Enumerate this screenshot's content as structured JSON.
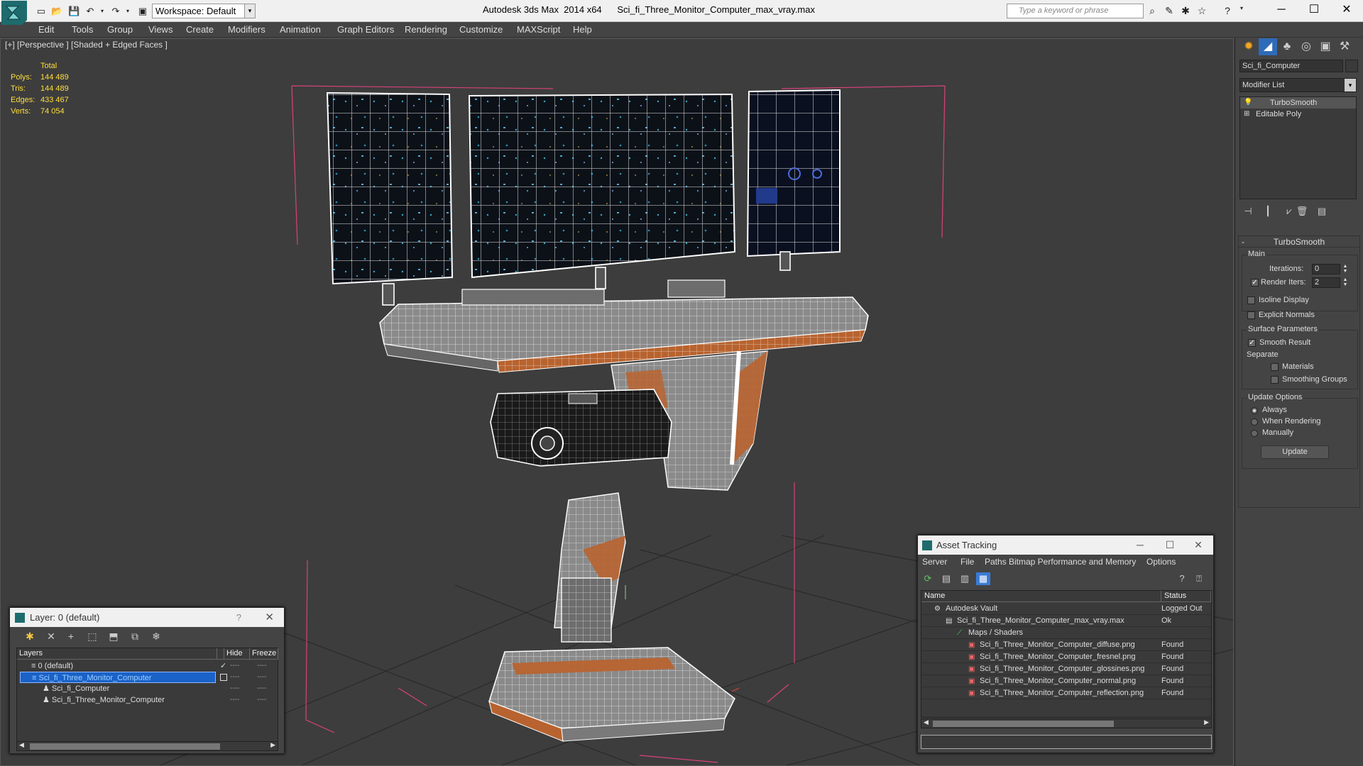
{
  "titlebar": {
    "app_title": "Autodesk 3ds Max  2014 x64",
    "file_name": "Sci_fi_Three_Monitor_Computer_max_vray.max",
    "workspace_label": "Workspace: Default",
    "search_placeholder": "Type a keyword or phrase"
  },
  "menu": [
    "Edit",
    "Tools",
    "Group",
    "Views",
    "Create",
    "Modifiers",
    "Animation",
    "Graph Editors",
    "Rendering",
    "Customize",
    "MAXScript",
    "Help"
  ],
  "viewport": {
    "label": "[+] [Perspective ] [Shaded + Edged Faces ]",
    "stats": {
      "header": "Total",
      "rows": [
        {
          "key": "Polys:",
          "value": "144 489"
        },
        {
          "key": "Tris:",
          "value": "144 489"
        },
        {
          "key": "Edges:",
          "value": "433 467"
        },
        {
          "key": "Verts:",
          "value": "74 054"
        }
      ]
    }
  },
  "command_panel": {
    "object_name": "Sci_fi_Computer",
    "modifier_list": "Modifier List",
    "stack": [
      "TurboSmooth",
      "Editable Poly"
    ],
    "turbosmooth": {
      "title": "TurboSmooth",
      "main_group": "Main",
      "iterations_label": "Iterations:",
      "iterations_value": "0",
      "render_iters_label": "Render Iters:",
      "render_iters_value": "2",
      "isoline": "Isoline Display",
      "explicit_normals": "Explicit Normals",
      "surface_group": "Surface Parameters",
      "smooth_result": "Smooth Result",
      "separate": "Separate",
      "materials": "Materials",
      "smoothing_groups": "Smoothing Groups",
      "update_group": "Update Options",
      "always": "Always",
      "when_rendering": "When Rendering",
      "manually": "Manually",
      "update_button": "Update"
    }
  },
  "layer_dialog": {
    "title": "Layer: 0 (default)",
    "help": "?",
    "columns": [
      "Layers",
      "Hide",
      "Freeze"
    ],
    "rows": [
      {
        "name": "0 (default)",
        "selected": false
      },
      {
        "name": "Sci_fi_Three_Monitor_Computer",
        "selected": true
      },
      {
        "name": "Sci_fi_Computer",
        "selected": false
      },
      {
        "name": "Sci_fi_Three_Monitor_Computer",
        "selected": false
      }
    ],
    "dash": "----"
  },
  "asset_dialog": {
    "title": "Asset Tracking",
    "menu": [
      "Server",
      "File",
      "Paths",
      "Bitmap Performance and Memory",
      "Options"
    ],
    "columns": [
      "Name",
      "Status"
    ],
    "rows": [
      {
        "name": "Autodesk Vault",
        "status": "Logged Out"
      },
      {
        "name": "Sci_fi_Three_Monitor_Computer_max_vray.max",
        "status": "Ok"
      },
      {
        "name": "Maps / Shaders",
        "status": ""
      },
      {
        "name": "Sci_fi_Three_Monitor_Computer_diffuse.png",
        "status": "Found"
      },
      {
        "name": "Sci_fi_Three_Monitor_Computer_fresnel.png",
        "status": "Found"
      },
      {
        "name": "Sci_fi_Three_Monitor_Computer_glossines.png",
        "status": "Found"
      },
      {
        "name": "Sci_fi_Three_Monitor_Computer_normal.png",
        "status": "Found"
      },
      {
        "name": "Sci_fi_Three_Monitor_Computer_reflection.png",
        "status": "Found"
      }
    ]
  },
  "colors": {
    "accent": "#1a62c8",
    "stats_text": "#ffde3b",
    "wire": "#ffffff",
    "copper": "#b8632f",
    "bbox": "#d9417b",
    "logo": "#1e6b6e"
  }
}
